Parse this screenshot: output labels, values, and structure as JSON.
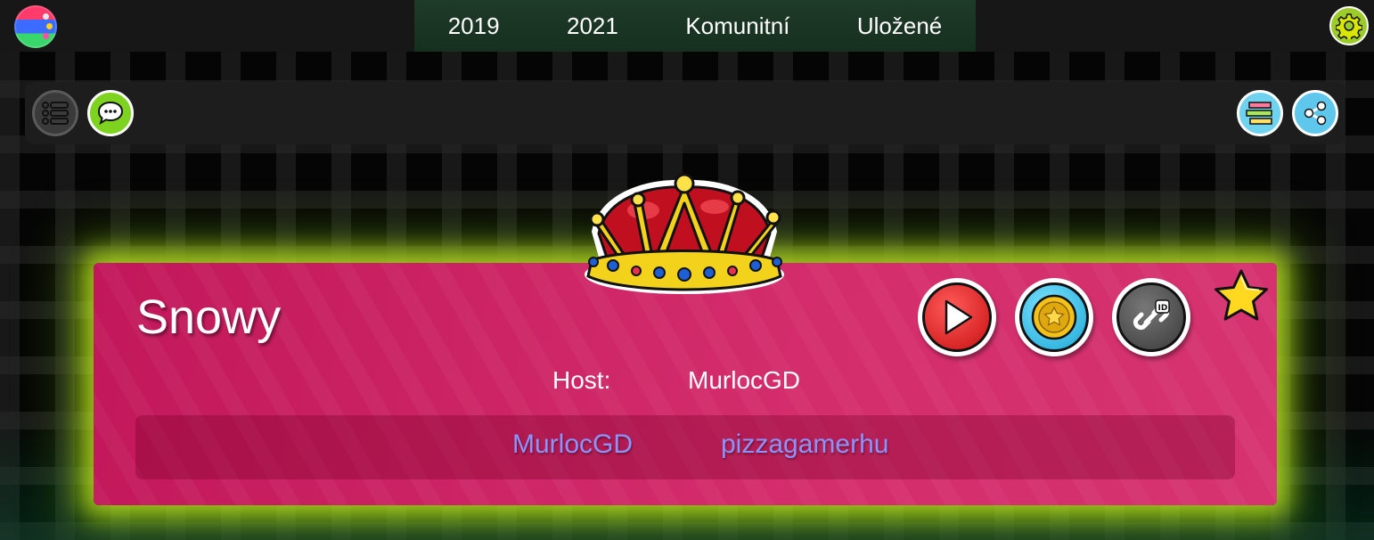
{
  "nav": {
    "items": [
      "2019",
      "2021",
      "Komunitní",
      "Uložené"
    ]
  },
  "card": {
    "level_name": "Snowy",
    "host_label": "Host:",
    "host_name": "MurlocGD",
    "creators": [
      "MurlocGD",
      "pizzagamerhu"
    ]
  },
  "icons": {
    "logo": "site-logo",
    "settings": "gear-icon",
    "list": "list-icon",
    "comments": "speech-bubble-icon",
    "sections": "stacked-bars-icon",
    "share": "share-icon",
    "play": "play-icon",
    "coin": "coin-icon",
    "link": "link-icon",
    "star": "star-icon",
    "crown": "crown-icon"
  },
  "colors": {
    "card": "#c2185b",
    "glow": "#c8f01e",
    "creator_link": "#8c93ff",
    "nav_bg": "#1e3a28"
  }
}
